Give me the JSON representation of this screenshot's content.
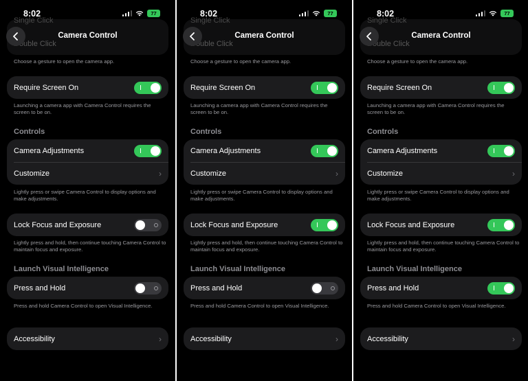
{
  "status": {
    "time": "8:02",
    "battery": "77"
  },
  "nav": {
    "title": "Camera Control"
  },
  "ghost": {
    "top": "Single Click",
    "bottom": "Double Click"
  },
  "gesture_footnote": "Choose a gesture to open the camera app.",
  "require_screen_on": {
    "label": "Require Screen On",
    "footnote": "Launching a camera app with Camera Control requires the screen to be on."
  },
  "controls": {
    "header": "Controls",
    "camera_adjustments": "Camera Adjustments",
    "customize": "Customize",
    "footnote": "Lightly press or swipe Camera Control to display options and make adjustments.",
    "lock_focus": "Lock Focus and Exposure",
    "lock_footnote": "Lightly press and hold, then continue touching Camera Control to maintain focus and exposure."
  },
  "visual_intelligence": {
    "header": "Launch Visual Intelligence",
    "press_hold": "Press and Hold",
    "footnote": "Press and hold Camera Control to open Visual Intelligence."
  },
  "accessibility": "Accessibility",
  "screens": [
    {
      "require_screen_on": true,
      "camera_adjustments": true,
      "lock_focus": false,
      "press_hold": false
    },
    {
      "require_screen_on": true,
      "camera_adjustments": true,
      "lock_focus": true,
      "press_hold": false
    },
    {
      "require_screen_on": true,
      "camera_adjustments": true,
      "lock_focus": true,
      "press_hold": true
    }
  ],
  "colors": {
    "toggle_on": "#34c759",
    "toggle_off": "#39393d",
    "card": "#1c1c1e",
    "background": "#000000"
  }
}
